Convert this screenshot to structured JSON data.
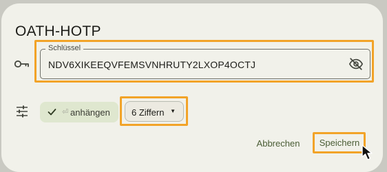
{
  "dialog": {
    "title": "OATH-HOTP",
    "secret_field": {
      "label": "Schlüssel",
      "value": "NDV6XIKEEQVFEMSVNHRUTY2LXOP4OCTJ",
      "visibility_icon": "eye-off-icon"
    },
    "options": {
      "settings_icon": "tune-icon",
      "append_chip": {
        "prefix": "⏎",
        "label": "anhängen",
        "selected": true,
        "icon": "check-icon"
      },
      "digits_dropdown": {
        "label": "6 Ziffern",
        "caret": "▼"
      }
    },
    "actions": {
      "cancel_label": "Abbrechen",
      "save_label": "Speichern"
    }
  },
  "colors": {
    "backdrop": "#c9c9c2",
    "surface": "#f1f1ea",
    "accent_text": "#4a5d35",
    "chip_selected": "#dfe7cf",
    "highlight": "#f2a328"
  }
}
